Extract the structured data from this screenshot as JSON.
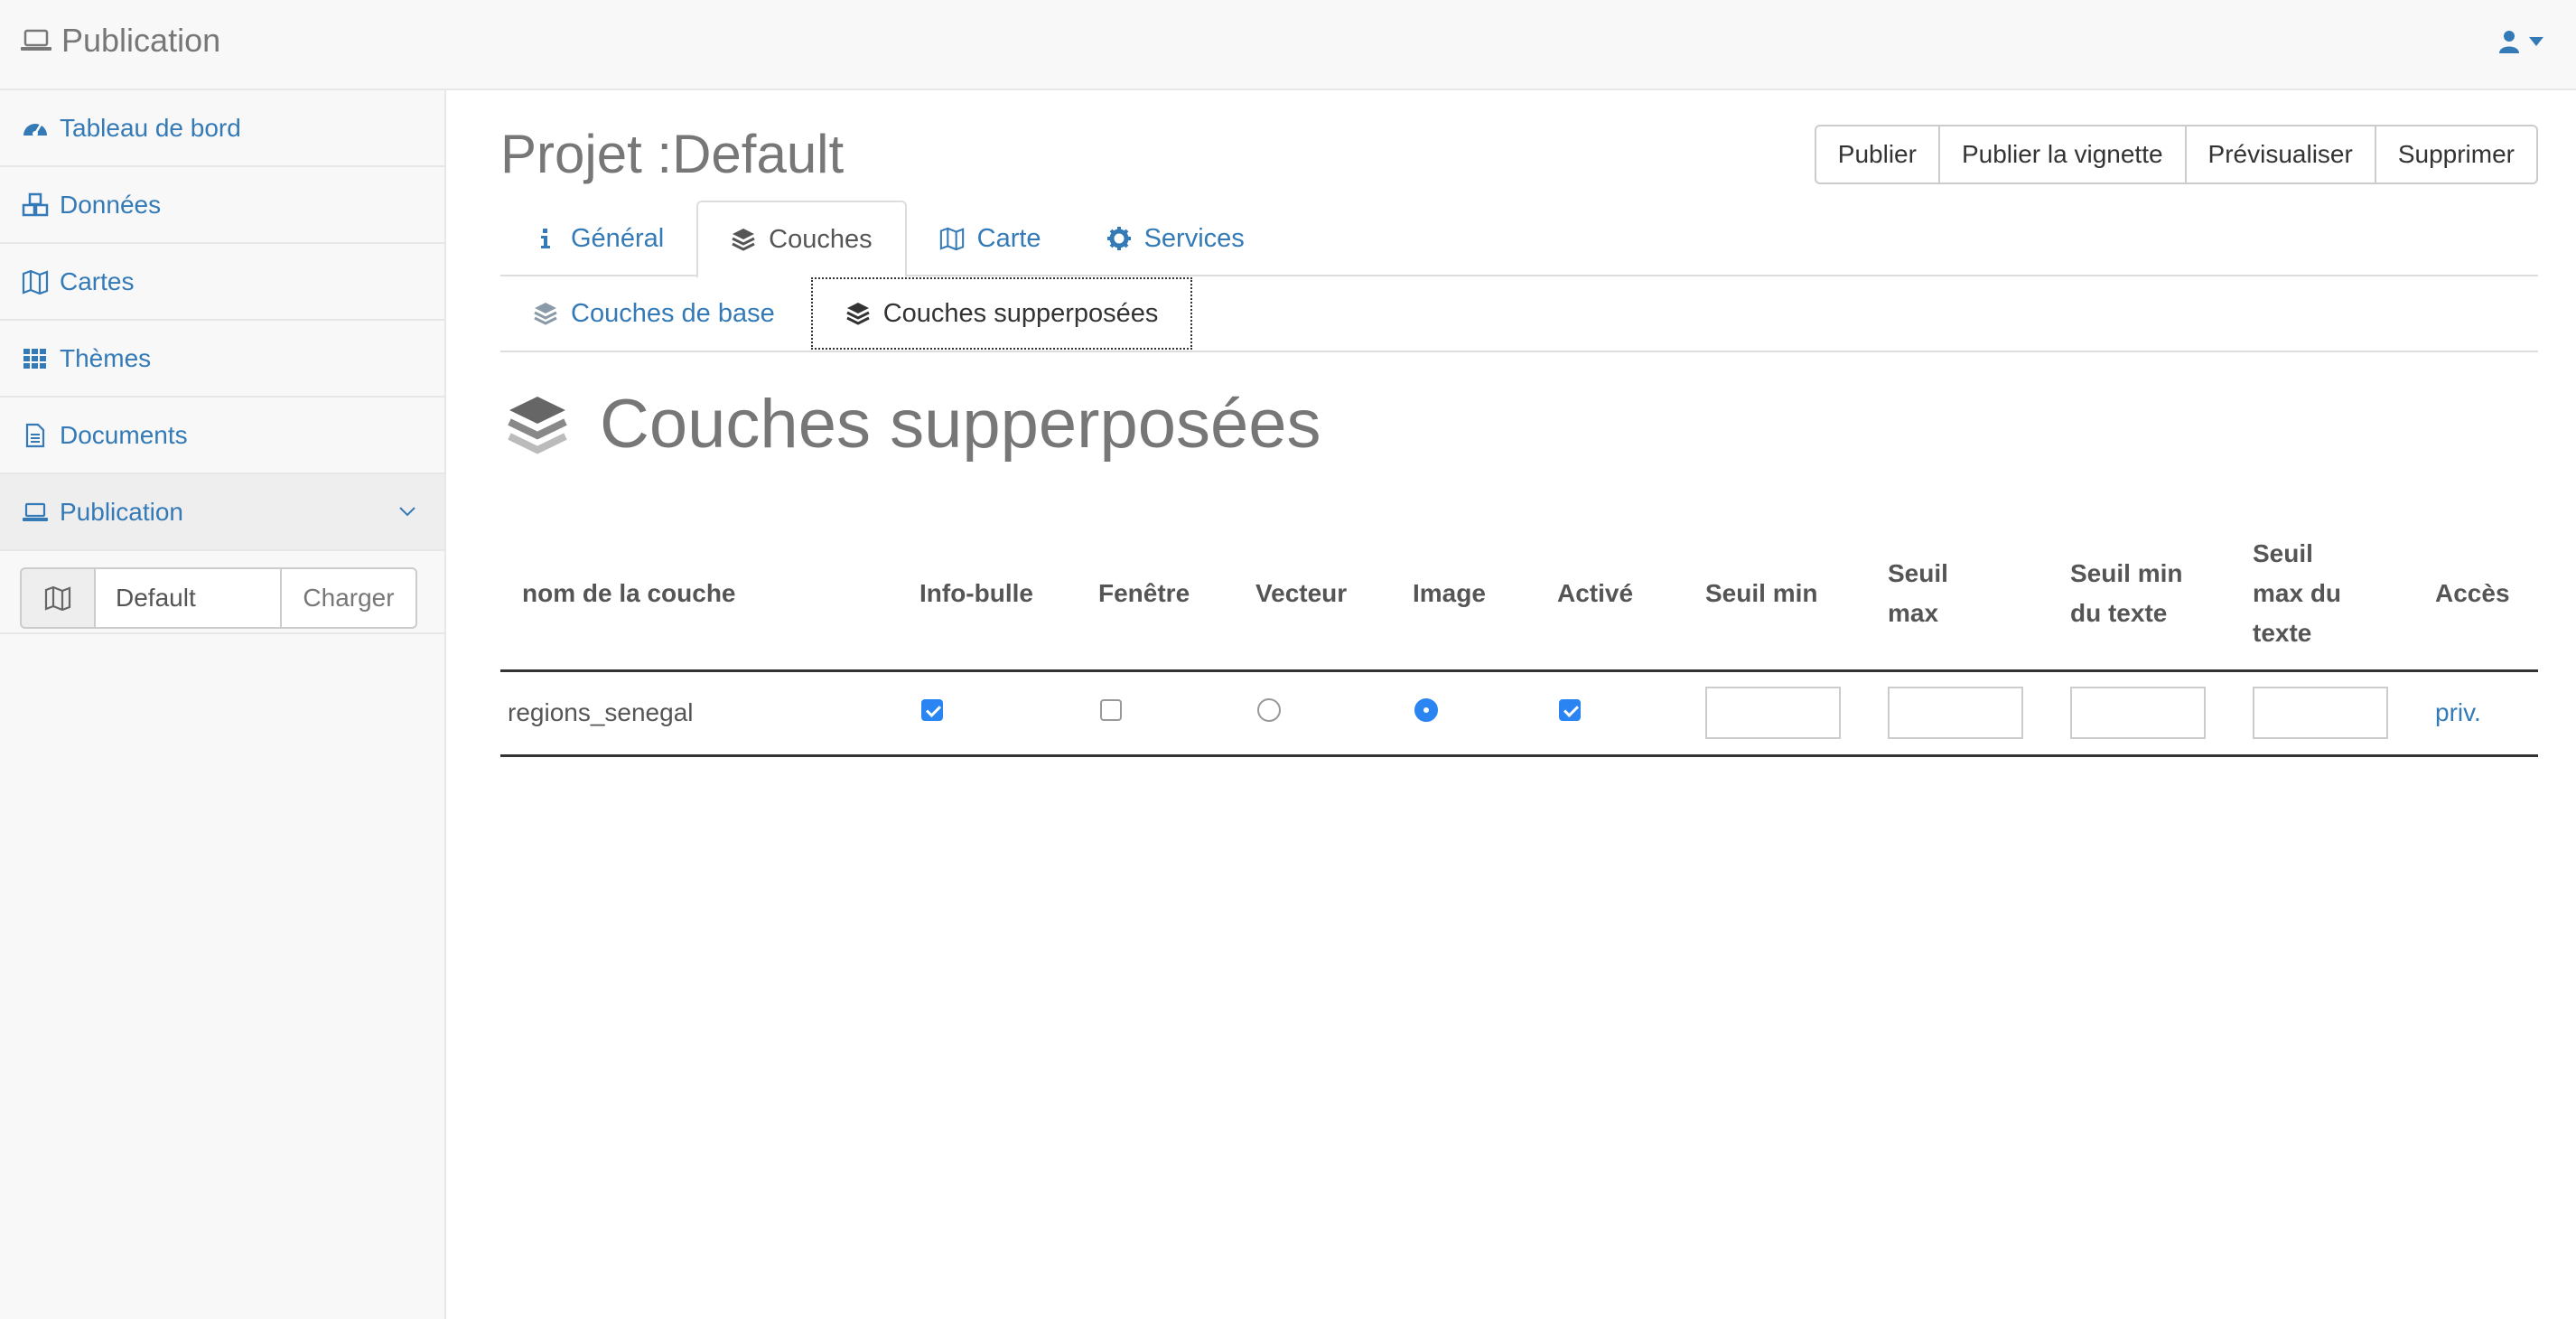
{
  "navbar": {
    "brand": "Publication",
    "brand_icon": "laptop-icon",
    "user_icon": "user-icon"
  },
  "sidebar": {
    "items": [
      {
        "label": "Tableau de bord",
        "icon": "dashboard-icon"
      },
      {
        "label": "Données",
        "icon": "cubes-icon"
      },
      {
        "label": "Cartes",
        "icon": "map-icon"
      },
      {
        "label": "Thèmes",
        "icon": "grid-icon"
      },
      {
        "label": "Documents",
        "icon": "document-icon"
      },
      {
        "label": "Publication",
        "icon": "laptop-icon",
        "active": true
      }
    ],
    "load": {
      "value": "Default",
      "button": "Charger"
    }
  },
  "main": {
    "title": "Projet :Default",
    "actions": [
      "Publier",
      "Publier la vignette",
      "Prévisualiser",
      "Supprimer"
    ],
    "tabs": [
      {
        "label": "Général",
        "icon": "info-icon"
      },
      {
        "label": "Couches",
        "icon": "layers-icon",
        "active": true
      },
      {
        "label": "Carte",
        "icon": "map-icon"
      },
      {
        "label": "Services",
        "icon": "gear-icon"
      }
    ],
    "subtabs": [
      {
        "label": "Couches de base",
        "icon": "layers-icon"
      },
      {
        "label": "Couches supperposées",
        "icon": "layers-icon",
        "active": true
      }
    ],
    "section_title": "Couches supperposées",
    "table": {
      "headers": [
        "nom de la couche",
        "Info-bulle",
        "Fenêtre",
        "Vecteur",
        "Image",
        "Activé",
        "Seuil min",
        "Seuil max",
        "Seuil min du texte",
        "Seuil max du texte",
        "Accès"
      ],
      "rows": [
        {
          "name": "regions_senegal",
          "info_bulle": true,
          "fenetre": false,
          "vecteur": false,
          "image": true,
          "active": true,
          "seuil_min": "",
          "seuil_max": "",
          "seuil_min_texte": "",
          "seuil_max_texte": "",
          "acces": "priv."
        }
      ]
    }
  },
  "colors": {
    "link": "#337ab7",
    "checked": "#2a84f1"
  }
}
